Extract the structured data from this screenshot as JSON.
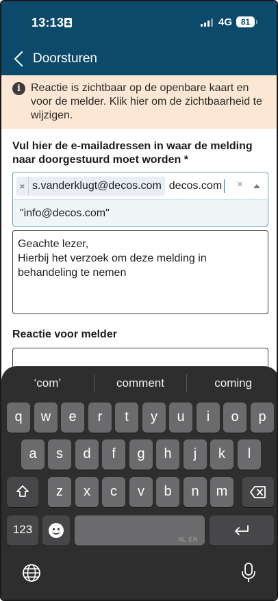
{
  "status_bar": {
    "time": "13:13",
    "network": "4G",
    "battery": "81"
  },
  "header": {
    "back_icon": "chevron-left-icon",
    "title": "Doorsturen"
  },
  "notice": {
    "icon": "info-icon",
    "icon_glyph": "i",
    "text": "Reactie is zichtbaar op de openbare kaart en voor de melder. Klik hier om de zichtbaarheid te wijzigen."
  },
  "form": {
    "email_label": "Vul hier de e-mailadressen in waar de melding naar doorgestuurd moet worden *",
    "selected_email": "s.vanderklugt@decos.com",
    "chip_remove": "×",
    "input_value": "decos.com",
    "clear_glyph": "×",
    "suggestion": "\"info@decos.com\"",
    "message": "Geachte lezer,\nHierbij het verzoek om deze melding in behandeling te nemen",
    "reaction_label": "Reactie voor melder"
  },
  "keyboard": {
    "predictions": [
      "‘com’",
      "comment",
      "coming"
    ],
    "row1": [
      "q",
      "w",
      "e",
      "r",
      "t",
      "y",
      "u",
      "i",
      "o",
      "p"
    ],
    "row2": [
      "a",
      "s",
      "d",
      "f",
      "g",
      "h",
      "j",
      "k",
      "l"
    ],
    "row3": [
      "z",
      "x",
      "c",
      "v",
      "b",
      "n",
      "m"
    ],
    "numbers_key": "123",
    "space_hint": "NL EN",
    "icons": [
      "shift-icon",
      "backspace-icon",
      "emoji-icon",
      "return-icon",
      "globe-icon",
      "mic-icon"
    ]
  },
  "colors": {
    "header": "#0b4a6a",
    "notice_bg": "#fbe7d3",
    "keyboard_bg": "#2e2e2f",
    "key": "#6b6b6d",
    "key_dark": "#474749"
  }
}
